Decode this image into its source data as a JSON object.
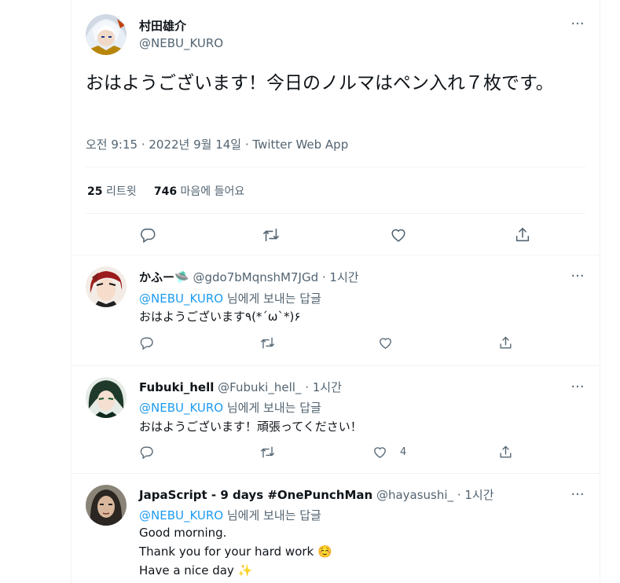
{
  "main_tweet": {
    "display_name": "村田雄介",
    "handle": "@NEBU_KURO",
    "text": "おはようございます！今日のノルマはペン入れ７枚です。",
    "meta": "오전 9:15 · 2022년 9월 14일 · Twitter Web App",
    "retweet_count": "25",
    "retweet_label": "리트윗",
    "like_count": "746",
    "like_label": "마음에 들어요"
  },
  "replies": [
    {
      "display_name": "かふー🛸",
      "handle": "@gdo7bMqnshM7JGd",
      "time": "· 1시간",
      "reply_to_mention": "@NEBU_KURO",
      "reply_to_suffix": " 님에게 보내는 답글",
      "lines": [
        "おはようございます٩(*´ω`*)۶"
      ],
      "like_count": ""
    },
    {
      "display_name": "Fubuki_hell",
      "handle": "@Fubuki_hell_",
      "time": "· 1시간",
      "reply_to_mention": "@NEBU_KURO",
      "reply_to_suffix": " 님에게 보내는 답글",
      "lines": [
        "おはようございます！頑張ってください！"
      ],
      "like_count": "4"
    },
    {
      "display_name": "JapaScript - 9 days #OnePunchMan",
      "handle": "@hayasushi_",
      "time": "· 1시간",
      "reply_to_mention": "@NEBU_KURO",
      "reply_to_suffix": " 님에게 보내는 답글",
      "lines": [
        "Good morning.",
        "Thank you for your hard work ☺️",
        "Have a nice day ✨"
      ],
      "like_count": ""
    }
  ],
  "colors": {
    "accent": "#1d9bf0",
    "secondary_text": "#536471",
    "border": "#eff3f4"
  },
  "icons": [
    "more-icon",
    "reply-icon",
    "retweet-icon",
    "like-icon",
    "share-icon"
  ]
}
